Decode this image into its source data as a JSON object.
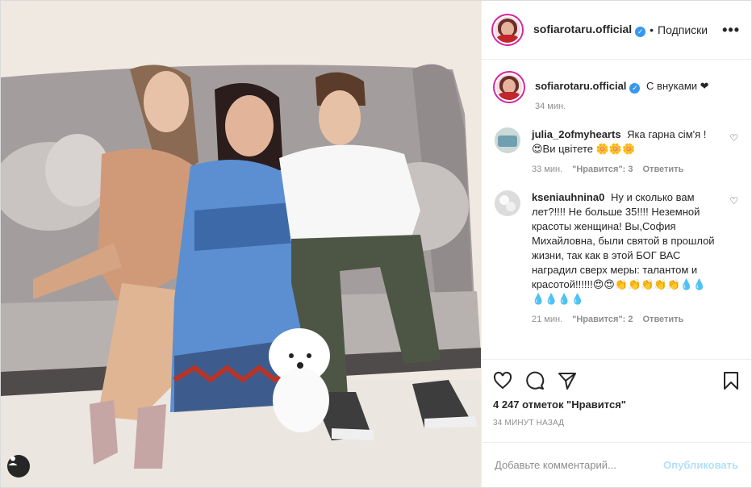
{
  "header": {
    "username": "sofiarotaru.official",
    "follow_label": "Подписки",
    "more_label": "•••"
  },
  "caption": {
    "username": "sofiarotaru.official",
    "text": "С внуками ❤",
    "time": "34 мин."
  },
  "comments": [
    {
      "username": "julia_2ofmyhearts",
      "text": "Яка гарна сім'я ! 😍Ви цвітете 🌼🌼🌼",
      "time": "33 мин.",
      "likes": "\"Нравится\": 3",
      "reply": "Ответить"
    },
    {
      "username": "kseniauhnina0",
      "text": "Ну и сколько вам лет?!!!! Не больше 35!!!! Неземной красоты женщина! Вы,София Михайловна, были святой в прошлой жизни, так как в этой БОГ ВАС наградил сверх меры: талантом и красотой!!!!!!😍😍👏👏👏👏👏💧💧💧💧💧💧",
      "time": "21 мин.",
      "likes": "\"Нравится\": 2",
      "reply": "Ответить"
    }
  ],
  "stats": {
    "likes": "4 247 отметок \"Нравится\"",
    "time": "34 минут назад"
  },
  "add_comment": {
    "placeholder": "Добавьте комментарий...",
    "publish": "Опубликовать"
  },
  "colors": {
    "verified": "#3897f0",
    "publish": "#b2dffc",
    "muted": "#8e8e8e"
  }
}
